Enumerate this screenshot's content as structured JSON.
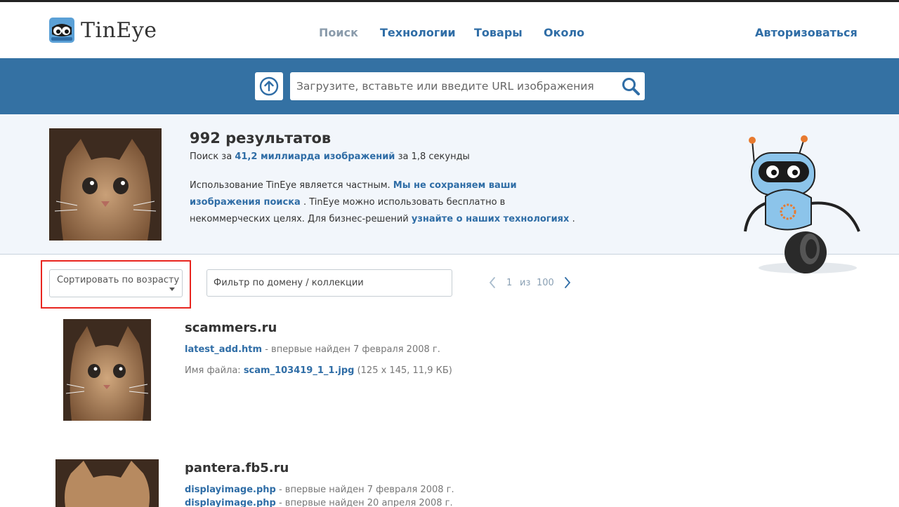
{
  "brand": {
    "name": "TinEye",
    "logo_icon": "tineye-robot-logo-icon"
  },
  "nav": {
    "items": [
      {
        "label": "Поиск",
        "active": true
      },
      {
        "label": "Технологии",
        "active": false
      },
      {
        "label": "Товары",
        "active": false
      },
      {
        "label": "Около",
        "active": false
      }
    ],
    "login_label": "Авторизоваться"
  },
  "search": {
    "placeholder": "Загрузите, вставьте или введите URL изображения",
    "upload_icon": "upload-arrow-icon",
    "search_icon": "magnifier-icon"
  },
  "summary": {
    "count_text": "992 результатов",
    "searched_prefix": "Поиск за",
    "searched_link": "41,2 миллиарда изображений",
    "searched_suffix": "за 1,8 секунды",
    "privacy_text_1": "Использование TinEye является частным.",
    "privacy_link_1": "Мы не сохраняем ваши изображения поиска",
    "privacy_text_2": ". TinEye можно использовать бесплатно в некоммерческих целях. Для бизнес-решений",
    "privacy_link_2": "узнайте о наших технологиях",
    "privacy_text_3": "."
  },
  "controls": {
    "sort_label": "Сортировать по возрасту",
    "filter_placeholder": "Фильтр по домену / коллекции",
    "page_current": "1",
    "page_of": "из",
    "page_total": "100"
  },
  "results": [
    {
      "domain": "scammers.ru",
      "page_link": "latest_add.htm",
      "found_text": "- впервые найден 7 февраля 2008 г.",
      "filename_label": "Имя файла:",
      "filename": "scam_103419_1_1.jpg",
      "file_info": "(125 x 145, 11,9 КБ)"
    },
    {
      "domain": "pantera.fb5.ru",
      "page_link": "displayimage.php",
      "found_text": "- впервые найден 7 февраля 2008 г.",
      "page_link_2": "displayimage.php",
      "found_text_2": "- впервые найден 20 апреля 2008 г."
    }
  ],
  "colors": {
    "accent": "#2f6da6",
    "bar": "#3471a3",
    "highlight": "#e8251f"
  }
}
